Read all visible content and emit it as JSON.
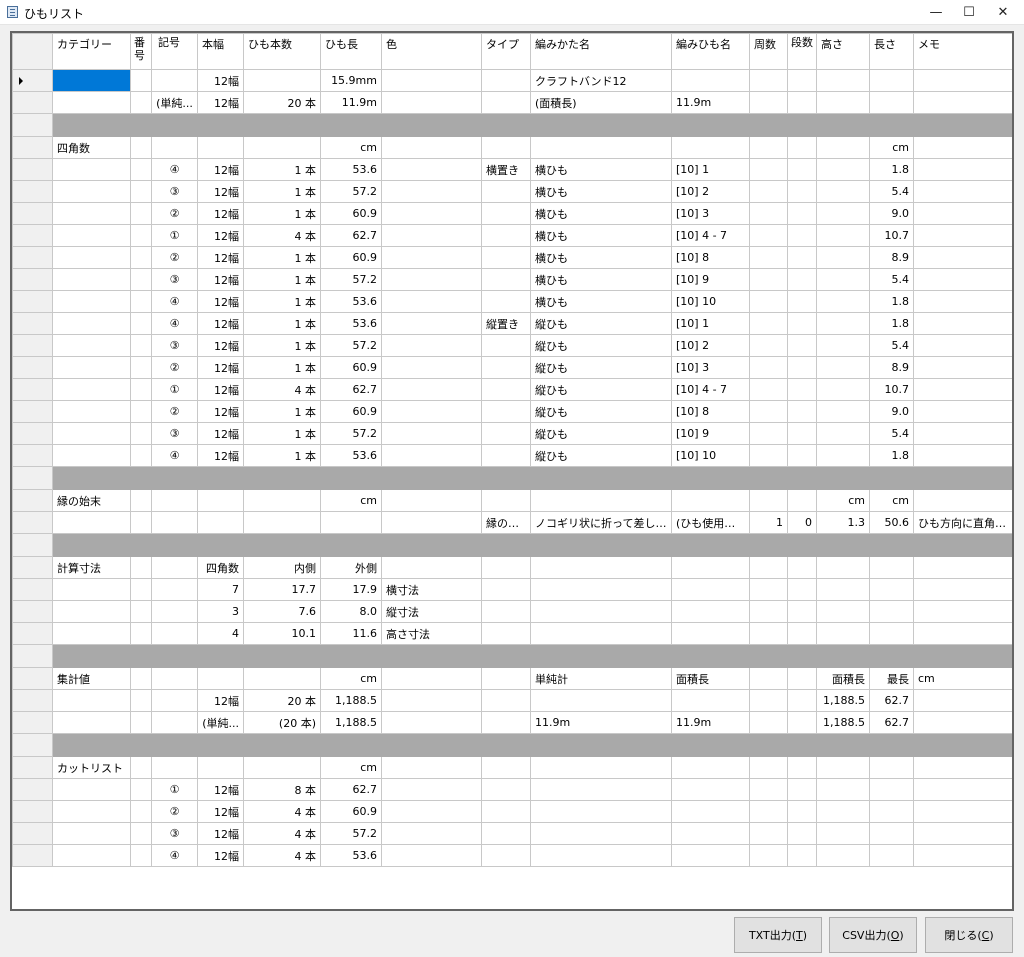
{
  "window": {
    "title": "ひもリスト",
    "minimize": "—",
    "maximize": "☐",
    "close": "✕"
  },
  "columns": [
    "カテゴリー",
    "番号",
    "記号",
    "本幅",
    "ひも本数",
    "ひも長",
    "色",
    "タイプ",
    "編みかた名",
    "編みひも名",
    "周数",
    "段数",
    "高さ",
    "長さ",
    "メモ"
  ],
  "rows": [
    {
      "current": true,
      "sel": true,
      "cells": [
        "",
        "",
        "",
        "12幅",
        "",
        "15.9mm",
        "",
        "",
        "クラフトバンド12",
        "",
        "",
        "",
        "",
        "",
        ""
      ]
    },
    {
      "cells": [
        "",
        "",
        "(単純...",
        "12幅",
        "20 本",
        "11.9m",
        "",
        "",
        "(面積長)",
        "11.9m",
        "",
        "",
        "",
        "",
        ""
      ]
    },
    {
      "sep": true
    },
    {
      "cells": [
        "四角数",
        "",
        "",
        "",
        "",
        "cm",
        "",
        "",
        "",
        "",
        "",
        "",
        "",
        "cm",
        ""
      ]
    },
    {
      "cells": [
        "",
        "",
        "④",
        "12幅",
        "1 本",
        "53.6",
        "",
        "横置き",
        "横ひも",
        "[10] 1",
        "",
        "",
        "",
        "1.8",
        ""
      ]
    },
    {
      "cells": [
        "",
        "",
        "③",
        "12幅",
        "1 本",
        "57.2",
        "",
        "",
        "横ひも",
        "[10] 2",
        "",
        "",
        "",
        "5.4",
        ""
      ]
    },
    {
      "cells": [
        "",
        "",
        "②",
        "12幅",
        "1 本",
        "60.9",
        "",
        "",
        "横ひも",
        "[10] 3",
        "",
        "",
        "",
        "9.0",
        ""
      ]
    },
    {
      "cells": [
        "",
        "",
        "①",
        "12幅",
        "4 本",
        "62.7",
        "",
        "",
        "横ひも",
        "[10] 4 - 7",
        "",
        "",
        "",
        "10.7",
        ""
      ]
    },
    {
      "cells": [
        "",
        "",
        "②",
        "12幅",
        "1 本",
        "60.9",
        "",
        "",
        "横ひも",
        "[10] 8",
        "",
        "",
        "",
        "8.9",
        ""
      ]
    },
    {
      "cells": [
        "",
        "",
        "③",
        "12幅",
        "1 本",
        "57.2",
        "",
        "",
        "横ひも",
        "[10] 9",
        "",
        "",
        "",
        "5.4",
        ""
      ]
    },
    {
      "cells": [
        "",
        "",
        "④",
        "12幅",
        "1 本",
        "53.6",
        "",
        "",
        "横ひも",
        "[10] 10",
        "",
        "",
        "",
        "1.8",
        ""
      ]
    },
    {
      "cells": [
        "",
        "",
        "④",
        "12幅",
        "1 本",
        "53.6",
        "",
        "縦置き",
        "縦ひも",
        "[10] 1",
        "",
        "",
        "",
        "1.8",
        ""
      ]
    },
    {
      "cells": [
        "",
        "",
        "③",
        "12幅",
        "1 本",
        "57.2",
        "",
        "",
        "縦ひも",
        "[10] 2",
        "",
        "",
        "",
        "5.4",
        ""
      ]
    },
    {
      "cells": [
        "",
        "",
        "②",
        "12幅",
        "1 本",
        "60.9",
        "",
        "",
        "縦ひも",
        "[10] 3",
        "",
        "",
        "",
        "8.9",
        ""
      ]
    },
    {
      "cells": [
        "",
        "",
        "①",
        "12幅",
        "4 本",
        "62.7",
        "",
        "",
        "縦ひも",
        "[10] 4 - 7",
        "",
        "",
        "",
        "10.7",
        ""
      ]
    },
    {
      "cells": [
        "",
        "",
        "②",
        "12幅",
        "1 本",
        "60.9",
        "",
        "",
        "縦ひも",
        "[10] 8",
        "",
        "",
        "",
        "9.0",
        ""
      ]
    },
    {
      "cells": [
        "",
        "",
        "③",
        "12幅",
        "1 本",
        "57.2",
        "",
        "",
        "縦ひも",
        "[10] 9",
        "",
        "",
        "",
        "5.4",
        ""
      ]
    },
    {
      "cells": [
        "",
        "",
        "④",
        "12幅",
        "1 本",
        "53.6",
        "",
        "",
        "縦ひも",
        "[10] 10",
        "",
        "",
        "",
        "1.8",
        ""
      ]
    },
    {
      "sep": true
    },
    {
      "cells": [
        "縁の始末",
        "",
        "",
        "",
        "",
        "cm",
        "",
        "",
        "",
        "",
        "",
        "",
        "cm",
        "cm",
        ""
      ]
    },
    {
      "cells": [
        "",
        "",
        "",
        "",
        "",
        "",
        "",
        "縁の始...",
        "ノコギリ状に折って差し込む",
        "(ひも使用なし)",
        "1",
        "0",
        "1.3",
        "50.6",
        "ひも方向に直角に..."
      ]
    },
    {
      "sep": true
    },
    {
      "cells": [
        "計算寸法",
        "",
        "",
        "四角数",
        "内側",
        "外側",
        "",
        "",
        "",
        "",
        "",
        "",
        "",
        "",
        ""
      ]
    },
    {
      "cells": [
        "",
        "",
        "",
        "7",
        "17.7",
        "17.9",
        "横寸法",
        "",
        "",
        "",
        "",
        "",
        "",
        "",
        ""
      ]
    },
    {
      "cells": [
        "",
        "",
        "",
        "3",
        "7.6",
        "8.0",
        "縦寸法",
        "",
        "",
        "",
        "",
        "",
        "",
        "",
        ""
      ]
    },
    {
      "cells": [
        "",
        "",
        "",
        "4",
        "10.1",
        "11.6",
        "高さ寸法",
        "",
        "",
        "",
        "",
        "",
        "",
        "",
        ""
      ]
    },
    {
      "sep": true
    },
    {
      "cells": [
        "集計値",
        "",
        "",
        "",
        "",
        "cm",
        "",
        "",
        "単純計",
        "面積長",
        "",
        "",
        "面積長",
        "最長",
        "cm"
      ]
    },
    {
      "cells": [
        "",
        "",
        "",
        "12幅",
        "20 本",
        "1,188.5",
        "",
        "",
        "",
        "",
        "",
        "",
        "1,188.5",
        "62.7",
        ""
      ]
    },
    {
      "cells": [
        "",
        "",
        "",
        "(単純...",
        "(20 本)",
        "1,188.5",
        "",
        "",
        "11.9m",
        "11.9m",
        "",
        "",
        "1,188.5",
        "62.7",
        ""
      ]
    },
    {
      "sep": true
    },
    {
      "cells": [
        "カットリスト",
        "",
        "",
        "",
        "",
        "cm",
        "",
        "",
        "",
        "",
        "",
        "",
        "",
        "",
        ""
      ]
    },
    {
      "cells": [
        "",
        "",
        "①",
        "12幅",
        "8 本",
        "62.7",
        "",
        "",
        "",
        "",
        "",
        "",
        "",
        "",
        ""
      ]
    },
    {
      "cells": [
        "",
        "",
        "②",
        "12幅",
        "4 本",
        "60.9",
        "",
        "",
        "",
        "",
        "",
        "",
        "",
        "",
        ""
      ]
    },
    {
      "cells": [
        "",
        "",
        "③",
        "12幅",
        "4 本",
        "57.2",
        "",
        "",
        "",
        "",
        "",
        "",
        "",
        "",
        ""
      ]
    },
    {
      "cells": [
        "",
        "",
        "④",
        "12幅",
        "4 本",
        "53.6",
        "",
        "",
        "",
        "",
        "",
        "",
        "",
        "",
        ""
      ]
    }
  ],
  "buttons": {
    "txt": {
      "label": "TXT出力(",
      "key": "T",
      "end": ")"
    },
    "csv": {
      "label": "CSV出力(",
      "key": "O",
      "end": ")"
    },
    "close": {
      "label": "閉じる(",
      "key": "C",
      "end": ")"
    }
  }
}
